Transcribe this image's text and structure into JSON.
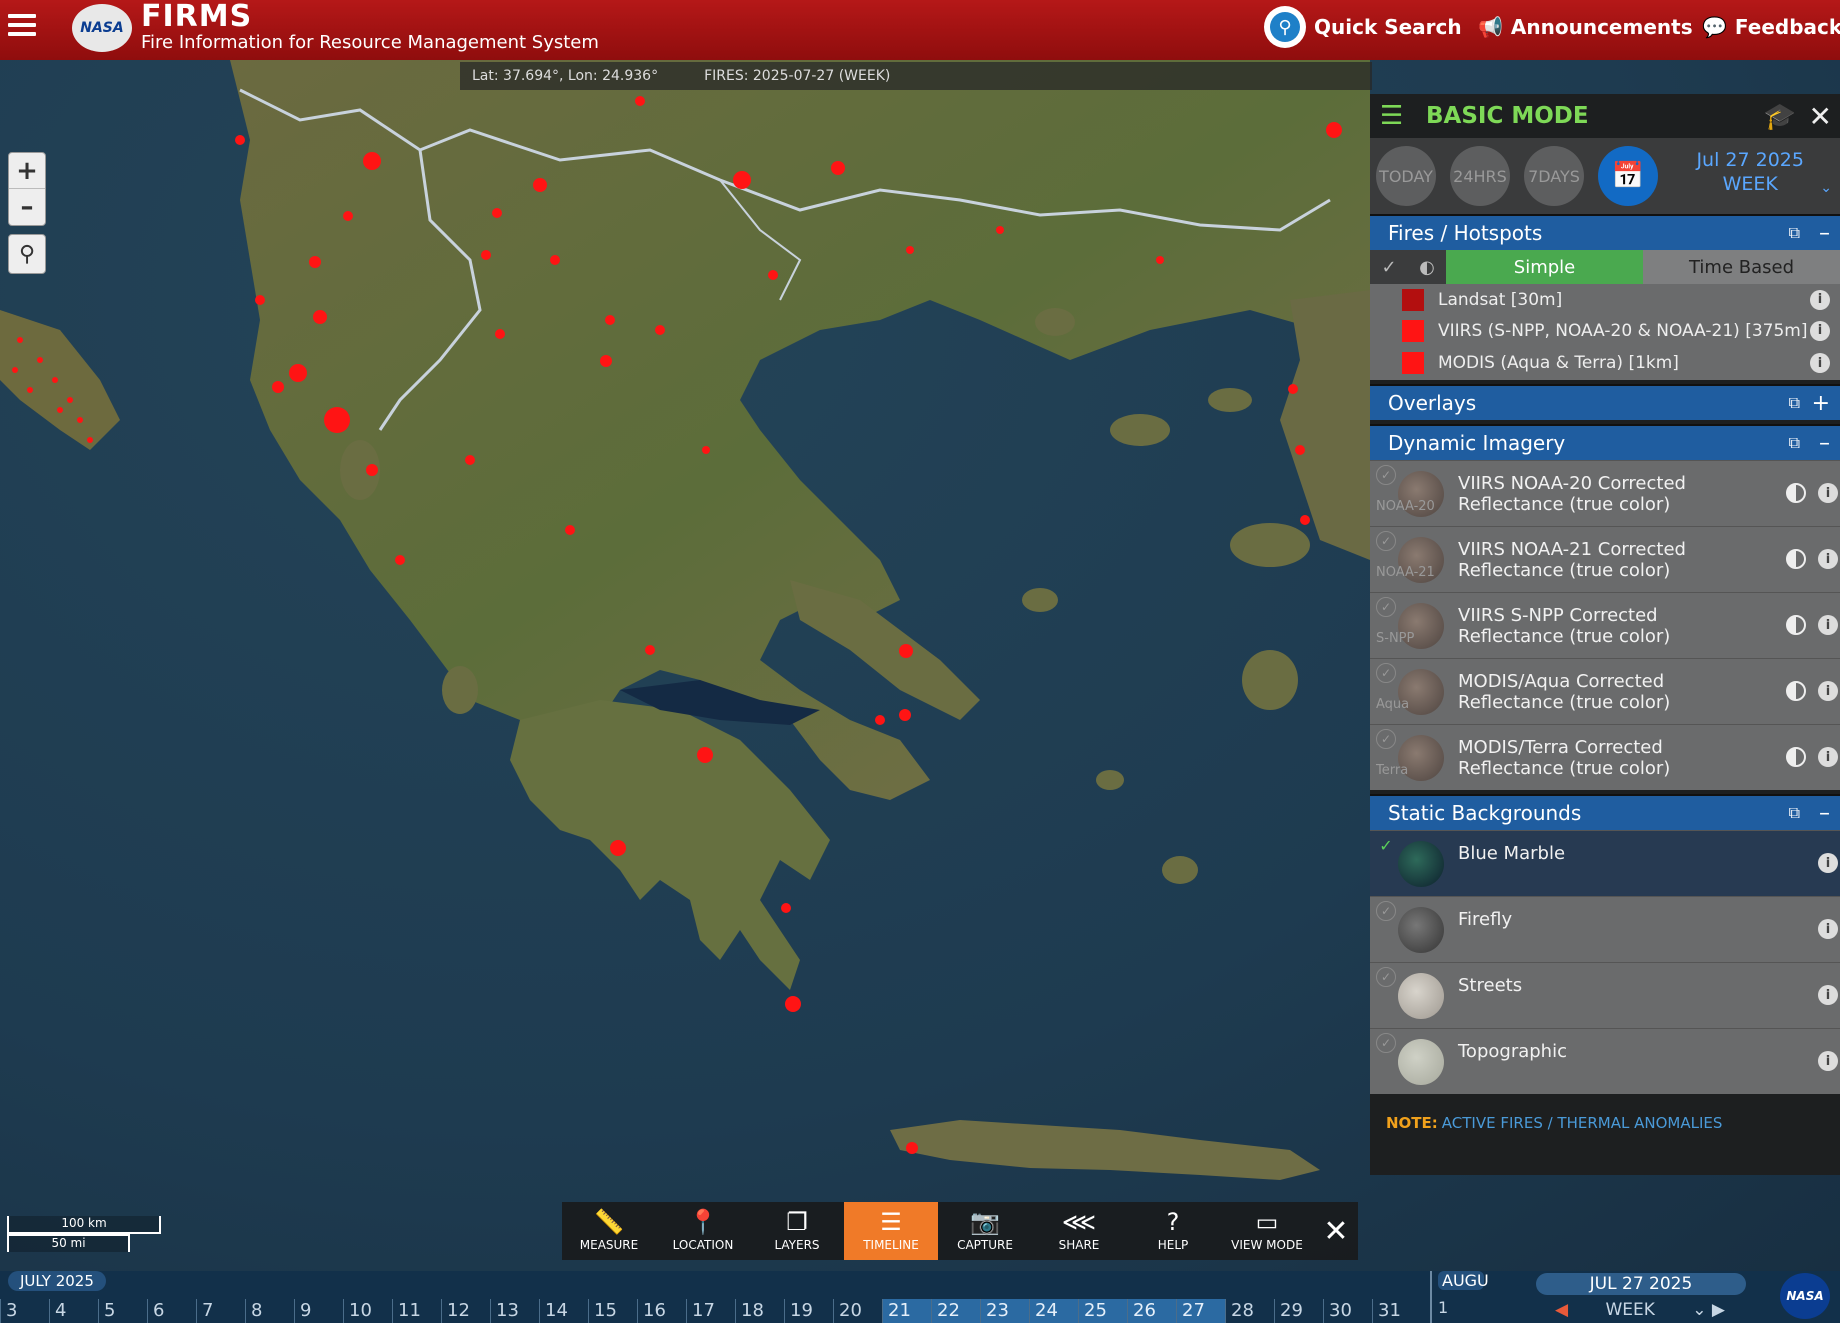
{
  "header": {
    "nasa_logo": "NASA",
    "app_title": "FIRMS",
    "app_subtitle": "Fire Information for Resource Management System",
    "quick_search": "Quick Search",
    "announcements": "Announcements",
    "feedback": "Feedback",
    "brand_color": "#a31313"
  },
  "map": {
    "coordinates": "Lat: 37.694°, Lon: 24.936°",
    "fires_label": "FIRES: 2025-07-27 (WEEK)",
    "zoom_in": "+",
    "zoom_out": "–",
    "scale_km": "100 km",
    "scale_mi": "50 mi",
    "fire_color": "#ff1414"
  },
  "toolbar": {
    "items": [
      {
        "label": "MEASURE",
        "icon": "ruler-icon"
      },
      {
        "label": "LOCATION",
        "icon": "pin-icon"
      },
      {
        "label": "LAYERS",
        "icon": "layers-icon"
      },
      {
        "label": "TIMELINE",
        "icon": "sliders-icon",
        "active": true
      },
      {
        "label": "CAPTURE",
        "icon": "camera-icon"
      },
      {
        "label": "SHARE",
        "icon": "share-icon"
      },
      {
        "label": "HELP",
        "icon": "help-icon"
      },
      {
        "label": "VIEW MODE",
        "icon": "monitor-icon"
      }
    ],
    "active_color": "#f07a28"
  },
  "timeline": {
    "month": "JULY 2025",
    "days": [
      "3",
      "4",
      "5",
      "6",
      "7",
      "8",
      "9",
      "10",
      "11",
      "12",
      "13",
      "14",
      "15",
      "16",
      "17",
      "18",
      "19",
      "20",
      "21",
      "22",
      "23",
      "24",
      "25",
      "26",
      "27",
      "28",
      "29",
      "30",
      "31"
    ],
    "selected_days": [
      "21",
      "22",
      "23",
      "24",
      "25",
      "26",
      "27"
    ],
    "next_month": "AUGU",
    "next_day": "1",
    "date": "JUL 27 2025",
    "period": "WEEK"
  },
  "panel": {
    "mode_title": "BASIC MODE",
    "periods": [
      "TODAY",
      "24HRS",
      "7DAYS"
    ],
    "date": "Jul 27 2025",
    "period": "WEEK",
    "fires_section": "Fires / Hotspots",
    "toggle_simple": "Simple",
    "toggle_time_based": "Time Based",
    "fire_layers": [
      {
        "label": "Landsat [30m]",
        "color": "#b30f0f"
      },
      {
        "label": "VIIRS (S-NPP, NOAA-20 & NOAA-21) [375m]",
        "color": "#ff1414"
      },
      {
        "label": "MODIS (Aqua & Terra) [1km]",
        "color": "#ff1414"
      }
    ],
    "overlays_section": "Overlays",
    "dynamic_section": "Dynamic Imagery",
    "dynamic_layers": [
      {
        "tag": "NOAA-20",
        "line1": "VIIRS NOAA-20 Corrected",
        "line2": "Reflectance (true color)"
      },
      {
        "tag": "NOAA-21",
        "line1": "VIIRS NOAA-21 Corrected",
        "line2": "Reflectance (true color)"
      },
      {
        "tag": "S-NPP",
        "line1": "VIIRS S-NPP Corrected",
        "line2": "Reflectance (true color)"
      },
      {
        "tag": "Aqua",
        "line1": "MODIS/Aqua Corrected",
        "line2": "Reflectance (true color)"
      },
      {
        "tag": "Terra",
        "line1": "MODIS/Terra Corrected",
        "line2": "Reflectance (true color)"
      }
    ],
    "static_section": "Static Backgrounds",
    "static_layers": [
      {
        "label": "Blue Marble",
        "selected": true
      },
      {
        "label": "Firefly",
        "selected": false
      },
      {
        "label": "Streets",
        "selected": false
      },
      {
        "label": "Topographic",
        "selected": false
      }
    ],
    "note_key": "NOTE:",
    "note_text": "ACTIVE FIRES / THERMAL ANOMALIES",
    "accent_color": "#7ed957",
    "section_color": "#1f5da0"
  }
}
